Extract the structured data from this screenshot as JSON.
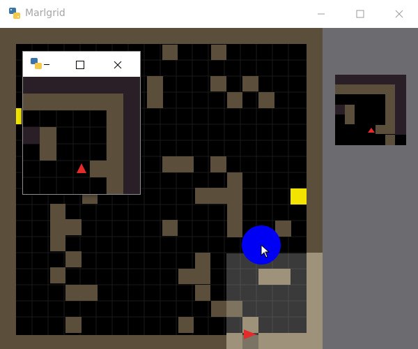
{
  "window": {
    "title": "Marlgrid",
    "controls": {
      "minimize": "minimize-icon",
      "maximize": "maximize-icon",
      "close": "close-icon"
    }
  },
  "child_window": {
    "controls": {
      "minimize": "minimize-icon",
      "maximize": "maximize-icon",
      "close": "close-icon"
    }
  },
  "icons": {
    "app": "python-icon",
    "agent": "triangle-icon",
    "goal": "yellow-square-icon",
    "cursor": "mouse-pointer-icon"
  },
  "colors": {
    "background": "#6c6c70",
    "wall": "#5b4f3b",
    "floor": "#000000",
    "grid_line": "#1a1a1a",
    "goal": "#f2e400",
    "agent": "#e52a2a",
    "agent_view_overlay": "rgba(200,200,200,0.30)",
    "blue_circle": "#0000f5",
    "child_wall": "#2a1e27"
  }
}
